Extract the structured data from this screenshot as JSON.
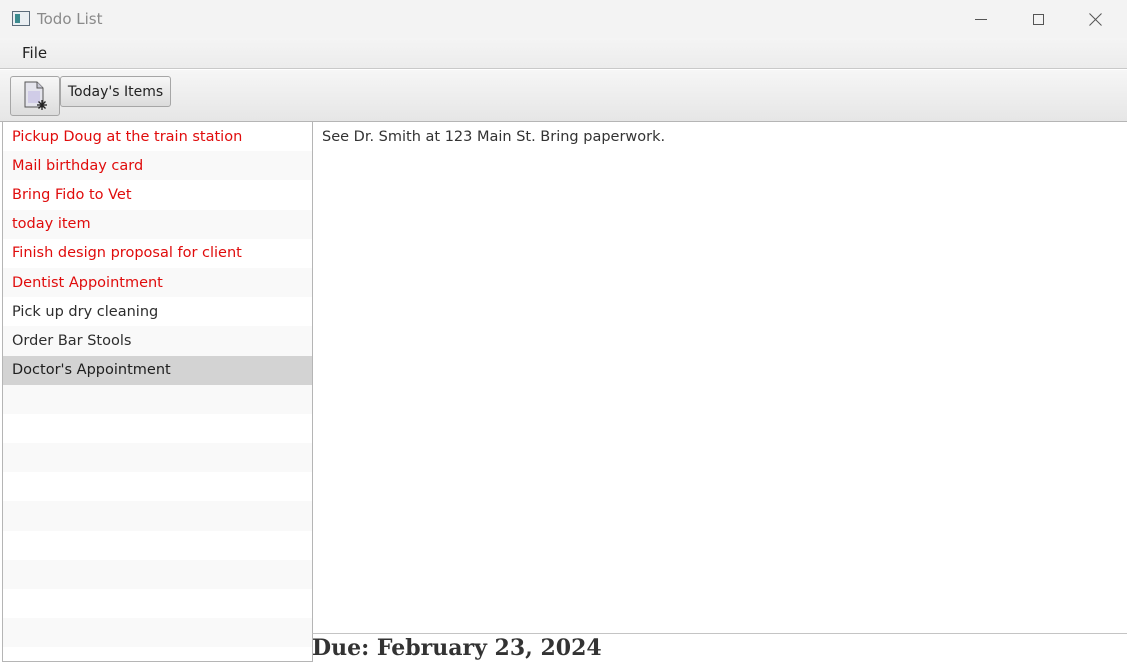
{
  "window": {
    "title": "Todo List"
  },
  "menu": {
    "file_label": "File"
  },
  "toolbar": {
    "new_icon": "new-document-icon",
    "today_label": "Today's Items"
  },
  "todo_list": {
    "items": [
      {
        "label": "Pickup Doug at the train station",
        "state": "overdue"
      },
      {
        "label": "Mail birthday card",
        "state": "overdue"
      },
      {
        "label": "Bring Fido to Vet",
        "state": "overdue"
      },
      {
        "label": "today item",
        "state": "overdue"
      },
      {
        "label": "Finish design proposal for client",
        "state": "overdue"
      },
      {
        "label": "Dentist Appointment",
        "state": "overdue"
      },
      {
        "label": "Pick up dry cleaning",
        "state": "normal"
      },
      {
        "label": "Order Bar Stools",
        "state": "normal"
      },
      {
        "label": "Doctor's Appointment",
        "state": "selected"
      }
    ],
    "colors": {
      "overdue": "#e00c0c",
      "normal": "#2e2e2e",
      "selected_bg": "#d3d3d3"
    }
  },
  "detail": {
    "text": "See Dr. Smith at 123 Main St. Bring paperwork.",
    "due": "Due: February 23, 2024"
  }
}
